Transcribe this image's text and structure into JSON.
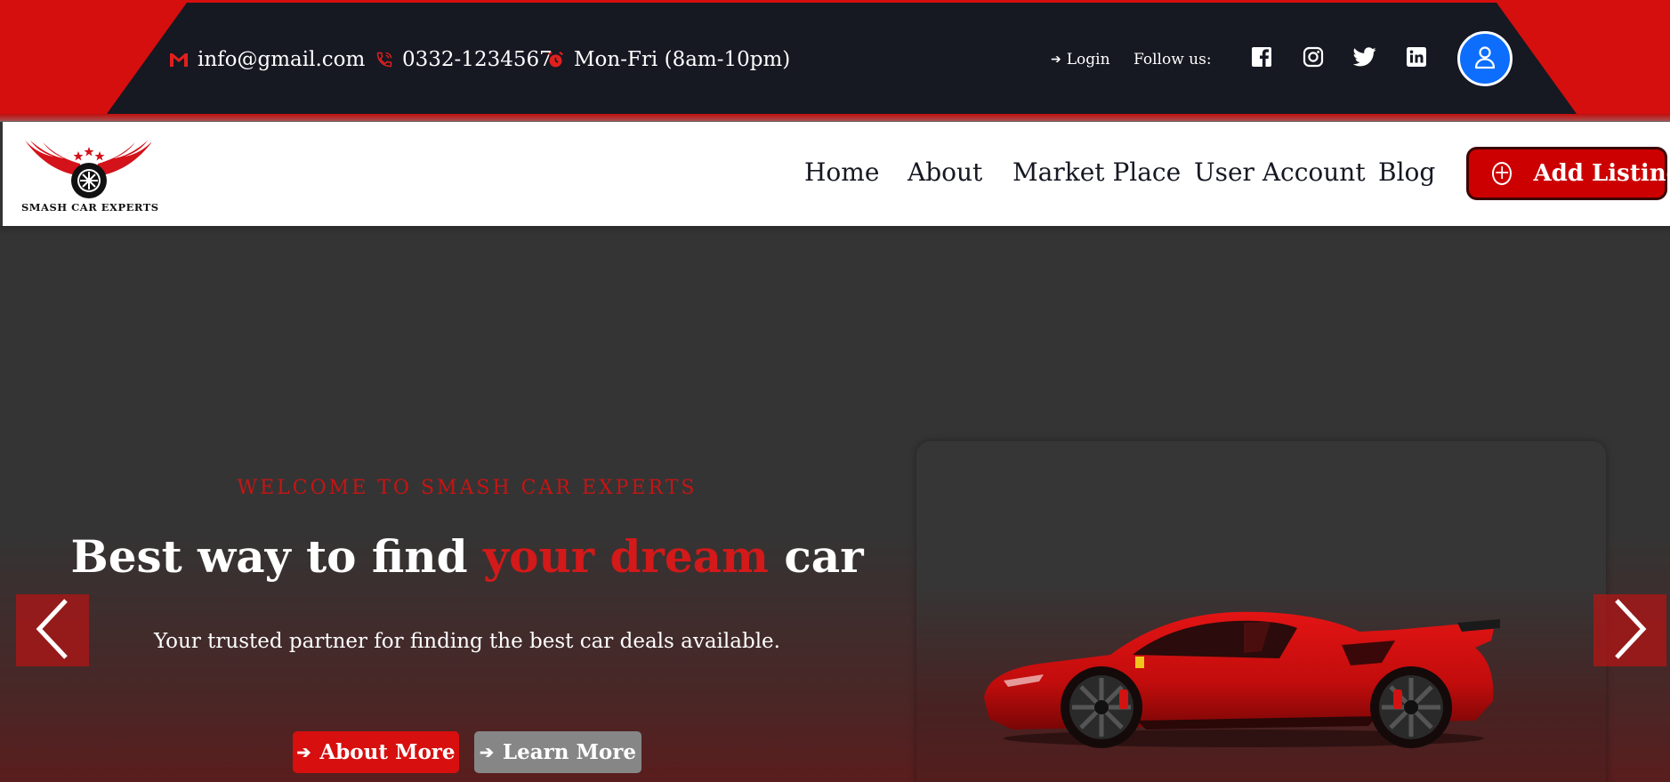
{
  "topbar": {
    "email": "info@gmail.com",
    "phone": "0332-1234567",
    "hours": "Mon-Fri (8am-10pm)",
    "login_label": "Login",
    "follow_label": "Follow us:",
    "social_icons": [
      "facebook-icon",
      "instagram-icon",
      "twitter-icon",
      "linkedin-icon"
    ],
    "avatar_icon": "user-icon"
  },
  "nav": {
    "logo_text": "SMASH CAR EXPERTS",
    "links": [
      "Home",
      "About",
      "Market Place",
      "User Account",
      "Blog"
    ],
    "add_listing_label": "Add Listing"
  },
  "hero": {
    "welcome": "WELCOME TO SMASH CAR EXPERTS",
    "headline_part1": "Best way to find ",
    "headline_highlight": "your dream",
    "headline_part2": " car",
    "subline": "Your trusted partner for finding the best car deals available.",
    "about_button": "About More",
    "learn_button": "Learn More"
  },
  "colors": {
    "brand_red": "#d50e0e",
    "dark_bar": "#161822",
    "avatar_blue": "#0d6efd",
    "learn_gray": "#868686"
  }
}
